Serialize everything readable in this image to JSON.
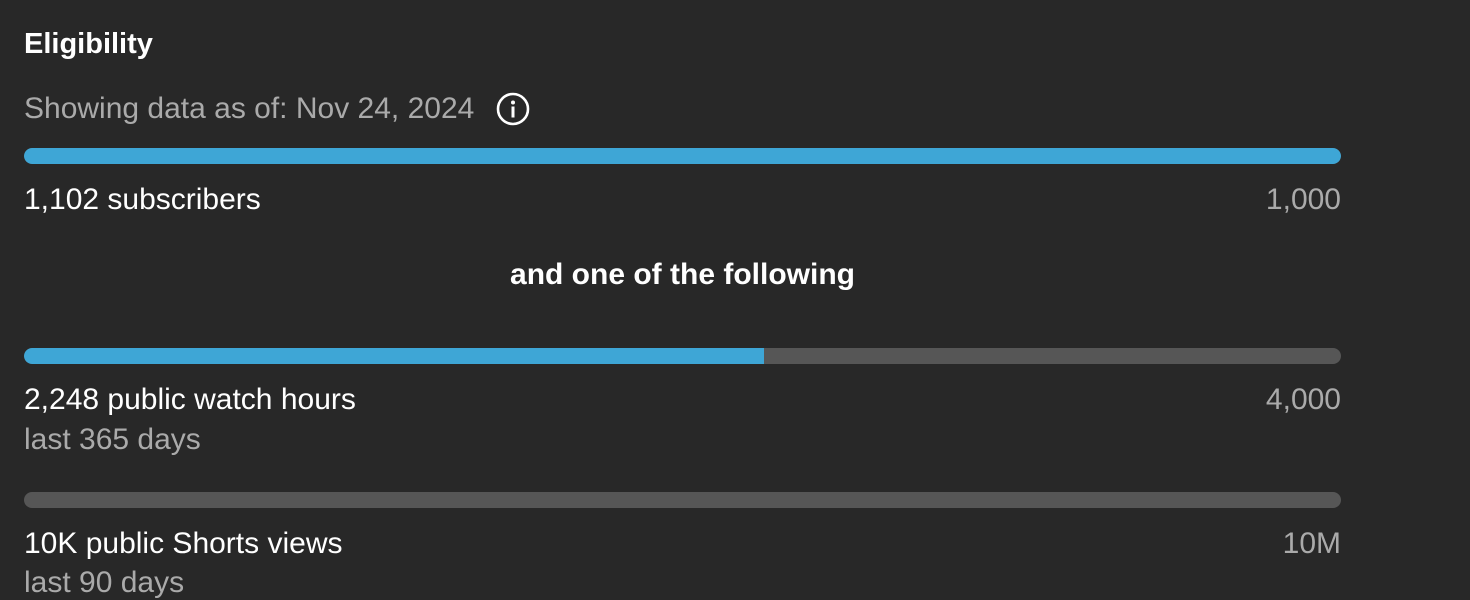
{
  "eligibility": {
    "title": "Eligibility",
    "as_of": "Showing data as of: Nov 24, 2024",
    "info_icon": "info-icon",
    "connector": "and one of the following",
    "requirements": [
      {
        "label": "1,102 subscribers",
        "target": "1,000",
        "subtext": "",
        "progress_fraction": 1.0
      },
      {
        "label": "2,248 public watch hours",
        "target": "4,000",
        "subtext": "last 365 days",
        "progress_fraction": 0.562
      },
      {
        "label": "10K public Shorts views",
        "target": "10M",
        "subtext": "last 90 days",
        "progress_fraction": 0.0
      }
    ]
  },
  "colors": {
    "background": "#282828",
    "bar_fill": "#3ea6d6",
    "bar_track": "#565656",
    "secondary_text": "#aaaaaa"
  }
}
